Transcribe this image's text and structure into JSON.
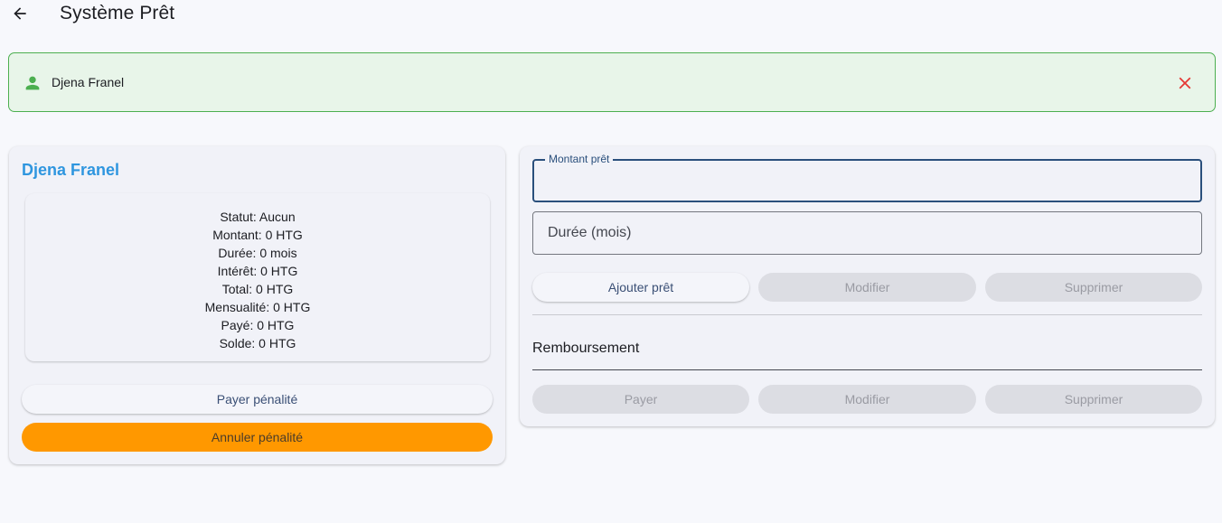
{
  "appbar": {
    "title": "Système Prêt",
    "back_icon": "arrow-left-icon"
  },
  "client_banner": {
    "name": "Djena Franel",
    "icon": "person-icon",
    "close_icon": "close-icon",
    "accent_color": "#4caf50",
    "close_color": "#e53935"
  },
  "loan_summary": {
    "client_name": "Djena Franel",
    "lines": [
      "Statut: Aucun",
      "Montant: 0 HTG",
      "Durée: 0 mois",
      "Intérêt: 0 HTG",
      "Total: 0 HTG",
      "Mensualité: 0 HTG",
      "Payé: 0 HTG",
      "Solde: 0 HTG"
    ],
    "pay_penalty_label": "Payer pénalité",
    "cancel_penalty_label": "Annuler pénalité"
  },
  "loan_form": {
    "amount_label": "Montant prêt",
    "amount_value": "",
    "duration_placeholder": "Durée (mois)",
    "add_label": "Ajouter prêt",
    "edit_label": "Modifier",
    "delete_label": "Supprimer"
  },
  "repayment": {
    "title": "Remboursement",
    "pay_label": "Payer",
    "edit_label": "Modifier",
    "delete_label": "Supprimer"
  },
  "colors": {
    "accent_blue": "#2f96df",
    "orange": "#ff9800"
  }
}
